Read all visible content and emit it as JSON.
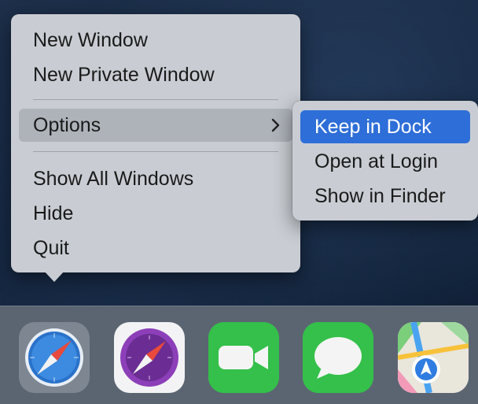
{
  "context_menu": {
    "items": [
      {
        "label": "New Window"
      },
      {
        "label": "New Private Window"
      },
      {
        "label": "Options",
        "highlighted": true,
        "has_submenu": true
      },
      {
        "label": "Show All Windows"
      },
      {
        "label": "Hide"
      },
      {
        "label": "Quit"
      }
    ],
    "submenu_chevron": "chevron-right-icon"
  },
  "options_submenu": {
    "items": [
      {
        "label": "Keep in Dock",
        "selected": true
      },
      {
        "label": "Open at Login"
      },
      {
        "label": "Show in Finder"
      }
    ]
  },
  "dock": {
    "apps": [
      {
        "name": "safari-icon",
        "state": "active"
      },
      {
        "name": "safari-technology-preview-icon"
      },
      {
        "name": "facetime-icon"
      },
      {
        "name": "messages-icon"
      },
      {
        "name": "maps-icon"
      }
    ]
  },
  "colors": {
    "menu_bg": "#c9cdd3",
    "menu_highlight": "#aeb3ba",
    "selection_blue": "#2e6ed8",
    "dock_bg": "#5b6572"
  }
}
